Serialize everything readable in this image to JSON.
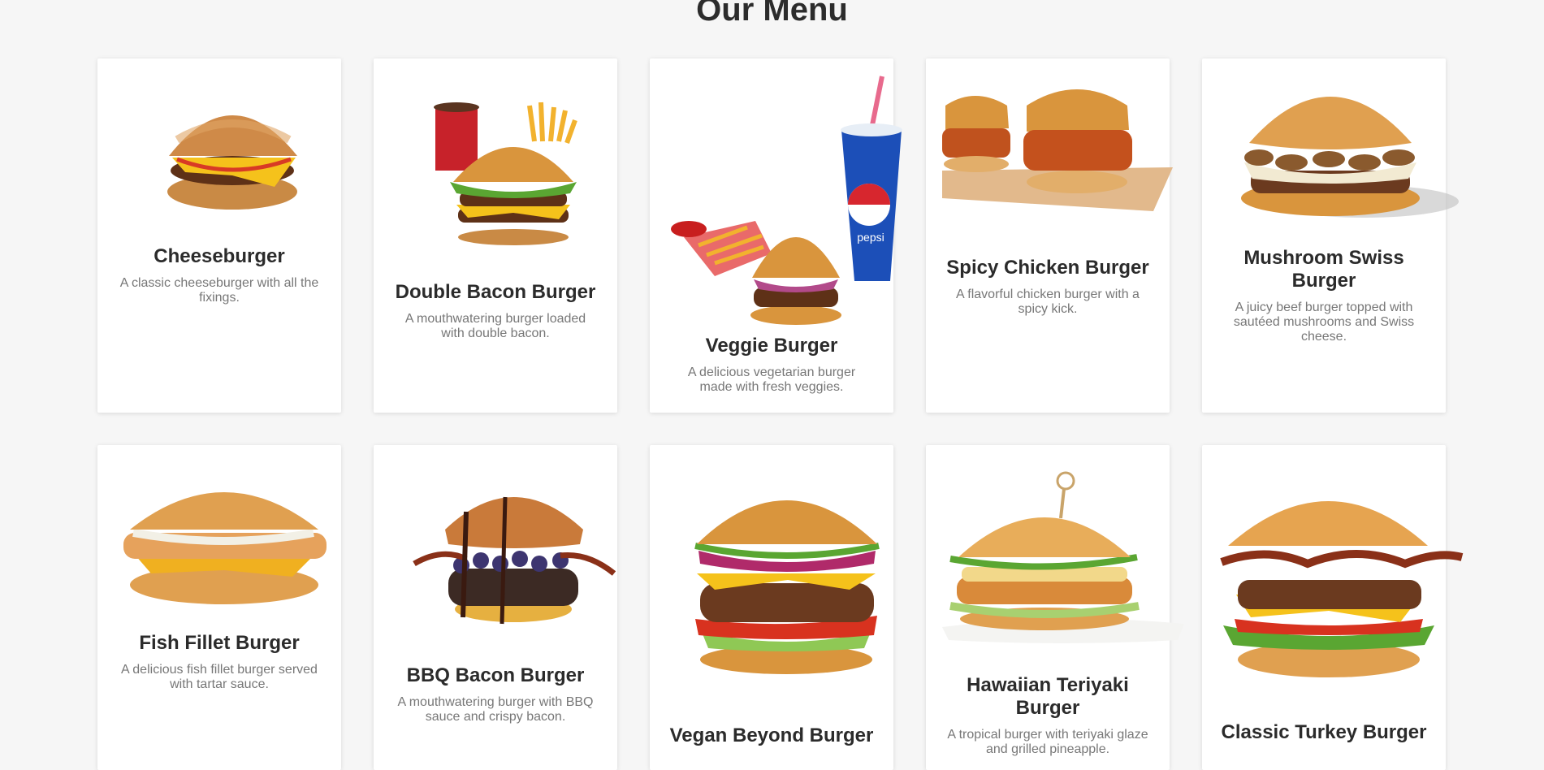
{
  "page": {
    "title": "Our Menu"
  },
  "menu": {
    "items": [
      {
        "name": "Cheeseburger",
        "description": "A classic cheeseburger with all the fixings."
      },
      {
        "name": "Double Bacon Burger",
        "description": "A mouthwatering burger loaded with double bacon."
      },
      {
        "name": "Veggie Burger",
        "description": "A delicious vegetarian burger made with fresh veggies."
      },
      {
        "name": "Spicy Chicken Burger",
        "description": "A flavorful chicken burger with a spicy kick."
      },
      {
        "name": "Mushroom Swiss Burger",
        "description": "A juicy beef burger topped with sautéed mushrooms and Swiss cheese."
      },
      {
        "name": "Fish Fillet Burger",
        "description": "A delicious fish fillet burger served with tartar sauce."
      },
      {
        "name": "BBQ Bacon Burger",
        "description": "A mouthwatering burger with BBQ sauce and crispy bacon."
      },
      {
        "name": "Vegan Beyond Burger",
        "description": ""
      },
      {
        "name": "Hawaiian Teriyaki Burger",
        "description": "A tropical burger with teriyaki glaze and grilled pineapple."
      },
      {
        "name": "Classic Turkey Burger",
        "description": ""
      }
    ]
  },
  "images": {
    "pepsi_label": "pepsi"
  },
  "colors": {
    "background": "#f6f6f6",
    "card": "#ffffff",
    "title": "#2c2c2c",
    "description": "#777777",
    "bun": "#d9953d",
    "patty": "#6b3a1f",
    "cheese": "#f5c21b",
    "lettuce": "#5aa632",
    "tomato": "#d8321f",
    "pepsi_blue": "#1c4fb8"
  }
}
